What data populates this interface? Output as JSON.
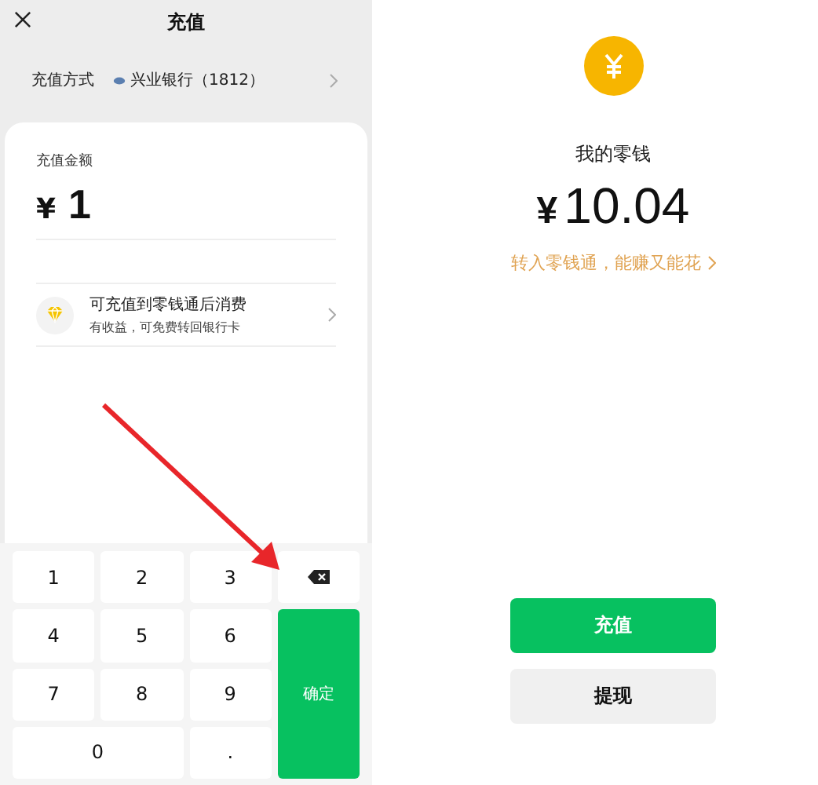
{
  "recharge": {
    "title": "充值",
    "method_label": "充值方式",
    "bank": "兴业银行（1812）",
    "amount_label": "充值金额",
    "currency": "¥",
    "amount": "1",
    "promo": {
      "title": "可充值到零钱通后消费",
      "subtitle": "有收益，可免费转回银行卡"
    },
    "keys": [
      {
        "kind": "digit",
        "label": "1"
      },
      {
        "kind": "digit",
        "label": "2"
      },
      {
        "kind": "digit",
        "label": "3"
      },
      {
        "kind": "delete"
      },
      {
        "kind": "digit",
        "label": "4"
      },
      {
        "kind": "digit",
        "label": "5"
      },
      {
        "kind": "digit",
        "label": "6"
      },
      {
        "kind": "digit",
        "label": "7"
      },
      {
        "kind": "digit",
        "label": "8"
      },
      {
        "kind": "digit",
        "label": "9"
      },
      {
        "kind": "zero",
        "label": "0"
      },
      {
        "kind": "digit",
        "label": "."
      },
      {
        "kind": "confirm",
        "label": "确定"
      }
    ]
  },
  "wallet": {
    "title": "我的零钱",
    "currency": "¥",
    "balance": "10.04",
    "link": "转入零钱通，能赚又能花",
    "buttons": [
      {
        "kind": "primary",
        "label": "充值"
      },
      {
        "kind": "secondary",
        "label": "提现"
      }
    ]
  }
}
